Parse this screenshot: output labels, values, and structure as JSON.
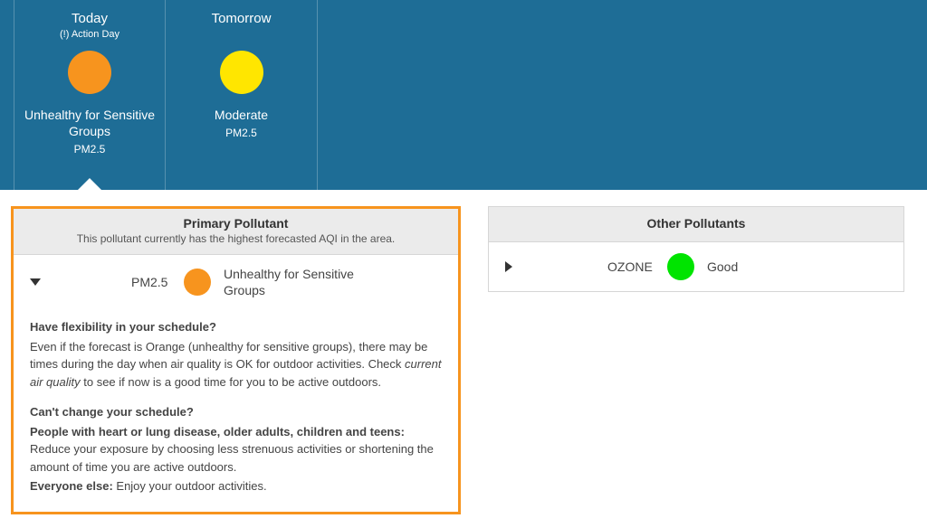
{
  "colors": {
    "orange": "#f7941e",
    "yellow": "#ffe600",
    "green": "#00e400"
  },
  "forecast": {
    "today": {
      "label": "Today",
      "action": "(!) Action Day",
      "category": "Unhealthy for Sensitive Groups",
      "pollutant": "PM2.5",
      "selected": true,
      "color_key": "orange"
    },
    "tomorrow": {
      "label": "Tomorrow",
      "action": "",
      "category": "Moderate",
      "pollutant": "PM2.5",
      "selected": false,
      "color_key": "yellow"
    }
  },
  "primary": {
    "title": "Primary Pollutant",
    "subtitle": "This pollutant currently has the highest forecasted AQI in the area.",
    "pollutant": "PM2.5",
    "category": "Unhealthy for Sensitive Groups",
    "color_key": "orange"
  },
  "advice": {
    "h1": "Have flexibility in your schedule?",
    "p1a": "Even if the forecast is Orange (unhealthy for sensitive groups), there may be times during the day when air quality is OK for outdoor activities. Check ",
    "p1em": "current air quality",
    "p1b": " to see if now is a good time for you to be active outdoors.",
    "h2": "Can't change your schedule?",
    "p2strong": "People with heart or lung disease, older adults, children and teens:",
    "p2": " Reduce your exposure by choosing less strenuous activities or shortening the amount of time you are active outdoors.",
    "p3strong": "Everyone else:",
    "p3": " Enjoy your outdoor activities."
  },
  "other": {
    "title": "Other Pollutants",
    "pollutant": "OZONE",
    "category": "Good",
    "color_key": "green"
  }
}
